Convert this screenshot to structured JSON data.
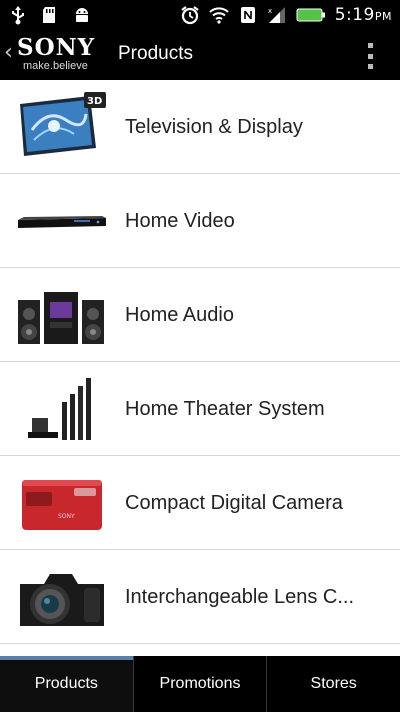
{
  "status_bar": {
    "time": "5:19",
    "ampm": "PM",
    "icons_left": [
      "usb-icon",
      "sd-card-icon",
      "android-debug-icon"
    ],
    "icons_right": [
      "alarm-clock-icon",
      "wifi-icon",
      "nfc-icon",
      "signal-icon",
      "battery-icon"
    ],
    "battery_color": "#55c24a"
  },
  "action_bar": {
    "back_glyph": "‹",
    "brand": "SONY",
    "tagline": "make.believe",
    "title": "Products"
  },
  "products": [
    {
      "label": "Television & Display",
      "icon": "television-icon"
    },
    {
      "label": "Home Video",
      "icon": "blu-ray-player-icon"
    },
    {
      "label": "Home Audio",
      "icon": "home-audio-system-icon"
    },
    {
      "label": "Home Theater System",
      "icon": "home-theater-icon"
    },
    {
      "label": "Compact Digital Camera",
      "icon": "compact-camera-icon"
    },
    {
      "label": "Interchangeable Lens C...",
      "icon": "dslr-camera-icon"
    }
  ],
  "tv_badge": "3D",
  "tabs": [
    {
      "label": "Products",
      "active": true
    },
    {
      "label": "Promotions",
      "active": false
    },
    {
      "label": "Stores",
      "active": false
    }
  ],
  "colors": {
    "accent_tab": "#5a7fa8",
    "camera_red": "#c8282d"
  }
}
